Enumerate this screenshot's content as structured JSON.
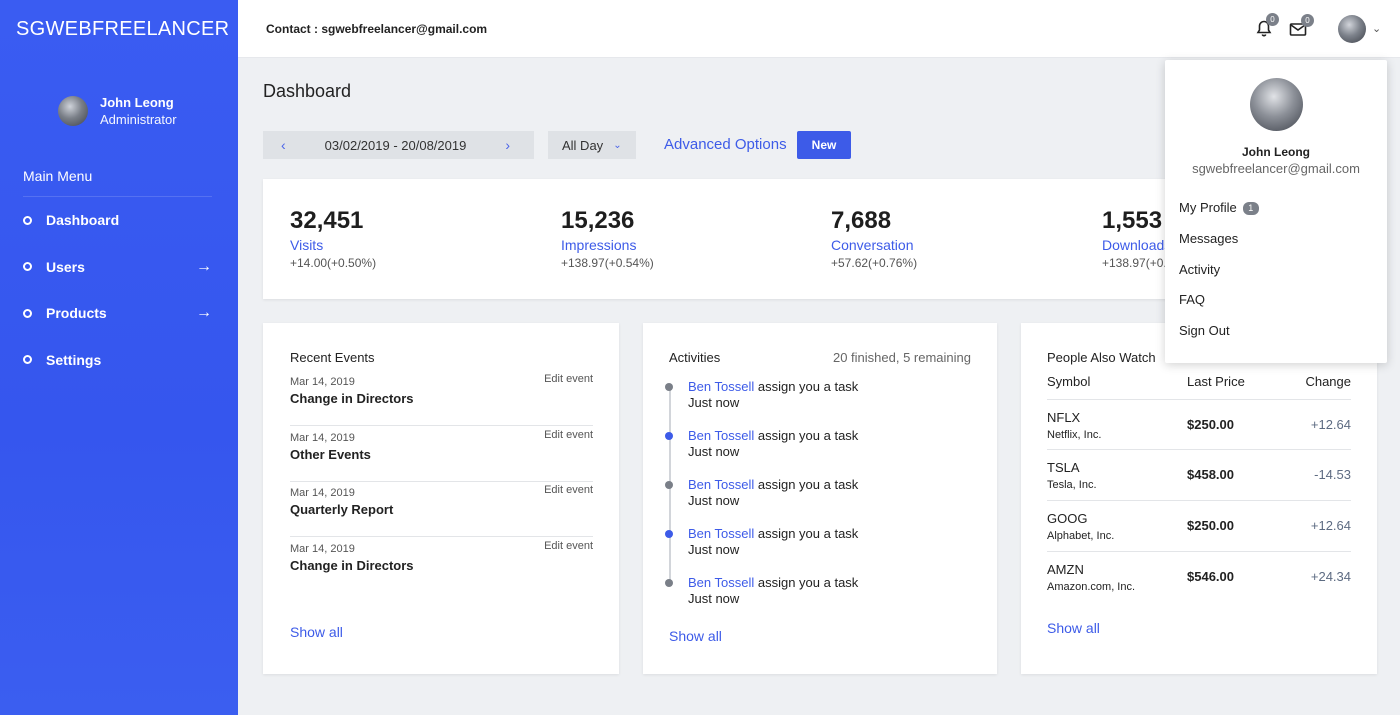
{
  "brand": "SGWEBFREELANCER",
  "sidebar": {
    "user_name": "John Leong",
    "user_role": "Administrator",
    "menu_title": "Main Menu",
    "items": [
      {
        "label": "Dashboard",
        "has_arrow": false
      },
      {
        "label": "Users",
        "has_arrow": true
      },
      {
        "label": "Products",
        "has_arrow": true
      },
      {
        "label": "Settings",
        "has_arrow": false
      }
    ],
    "arrow_glyph": "→"
  },
  "topbar": {
    "contact": "Contact : sgwebfreelancer@gmail.com",
    "notifications_count": "0",
    "messages_count": "0",
    "chevron": "⌄"
  },
  "page_title": "Dashboard",
  "filters": {
    "prev": "‹",
    "next": "›",
    "date_range": "03/02/2019 - 20/08/2019",
    "period": "All Day",
    "period_chevron": "⌄",
    "advanced": "Advanced Options",
    "new_button": "New"
  },
  "stats": [
    {
      "value": "32,451",
      "label": "Visits",
      "delta": "+14.00(+0.50%)"
    },
    {
      "value": "15,236",
      "label": "Impressions",
      "delta": "+138.97(+0.54%)"
    },
    {
      "value": "7,688",
      "label": "Conversation",
      "delta": "+57.62(+0.76%)"
    },
    {
      "value": "1,553",
      "label": "Downloads",
      "delta": "+138.97(+0.54%)"
    }
  ],
  "recent_events": {
    "title": "Recent Events",
    "edit_label": "Edit event",
    "items": [
      {
        "date": "Mar 14, 2019",
        "title": "Change in Directors"
      },
      {
        "date": "Mar 14, 2019",
        "title": "Other Events"
      },
      {
        "date": "Mar 14, 2019",
        "title": "Quarterly Report"
      },
      {
        "date": "Mar 14, 2019",
        "title": "Change in Directors"
      }
    ],
    "show_all": "Show all"
  },
  "activities": {
    "title": "Activities",
    "summary": "20 finished, 5 remaining",
    "items": [
      {
        "who": "Ben Tossell",
        "text": " assign you a task",
        "time": "Just now",
        "dot": "#7a7f88"
      },
      {
        "who": "Ben Tossell",
        "text": " assign you a task",
        "time": "Just now",
        "dot": "#3d5be8"
      },
      {
        "who": "Ben Tossell",
        "text": " assign you a task",
        "time": "Just now",
        "dot": "#7a7f88"
      },
      {
        "who": "Ben Tossell",
        "text": " assign you a task",
        "time": "Just now",
        "dot": "#3d5be8"
      },
      {
        "who": "Ben Tossell",
        "text": " assign you a task",
        "time": "Just now",
        "dot": "#7a7f88"
      }
    ],
    "show_all": "Show all"
  },
  "watch": {
    "title": "People Also Watch",
    "headers": {
      "symbol": "Symbol",
      "price": "Last Price",
      "change": "Change"
    },
    "rows": [
      {
        "symbol": "NFLX",
        "name": "Netflix, Inc.",
        "price": "$250.00",
        "change": "+12.64"
      },
      {
        "symbol": "TSLA",
        "name": "Tesla, Inc.",
        "price": "$458.00",
        "change": "-14.53"
      },
      {
        "symbol": "GOOG",
        "name": "Alphabet, Inc.",
        "price": "$250.00",
        "change": "+12.64"
      },
      {
        "symbol": "AMZN",
        "name": "Amazon.com, Inc.",
        "price": "$546.00",
        "change": "+24.34"
      }
    ],
    "show_all": "Show all"
  },
  "profile_menu": {
    "name": "John Leong",
    "email": "sgwebfreelancer@gmail.com",
    "items": [
      {
        "label": "My Profile",
        "badge": "1"
      },
      {
        "label": "Messages",
        "badge": ""
      },
      {
        "label": "Activity",
        "badge": ""
      },
      {
        "label": "FAQ",
        "badge": ""
      },
      {
        "label": "Sign Out",
        "badge": ""
      }
    ]
  },
  "colors": {
    "accent": "#3d5be8",
    "sidebar": "#3a5cf2",
    "background": "#eef0f3"
  }
}
